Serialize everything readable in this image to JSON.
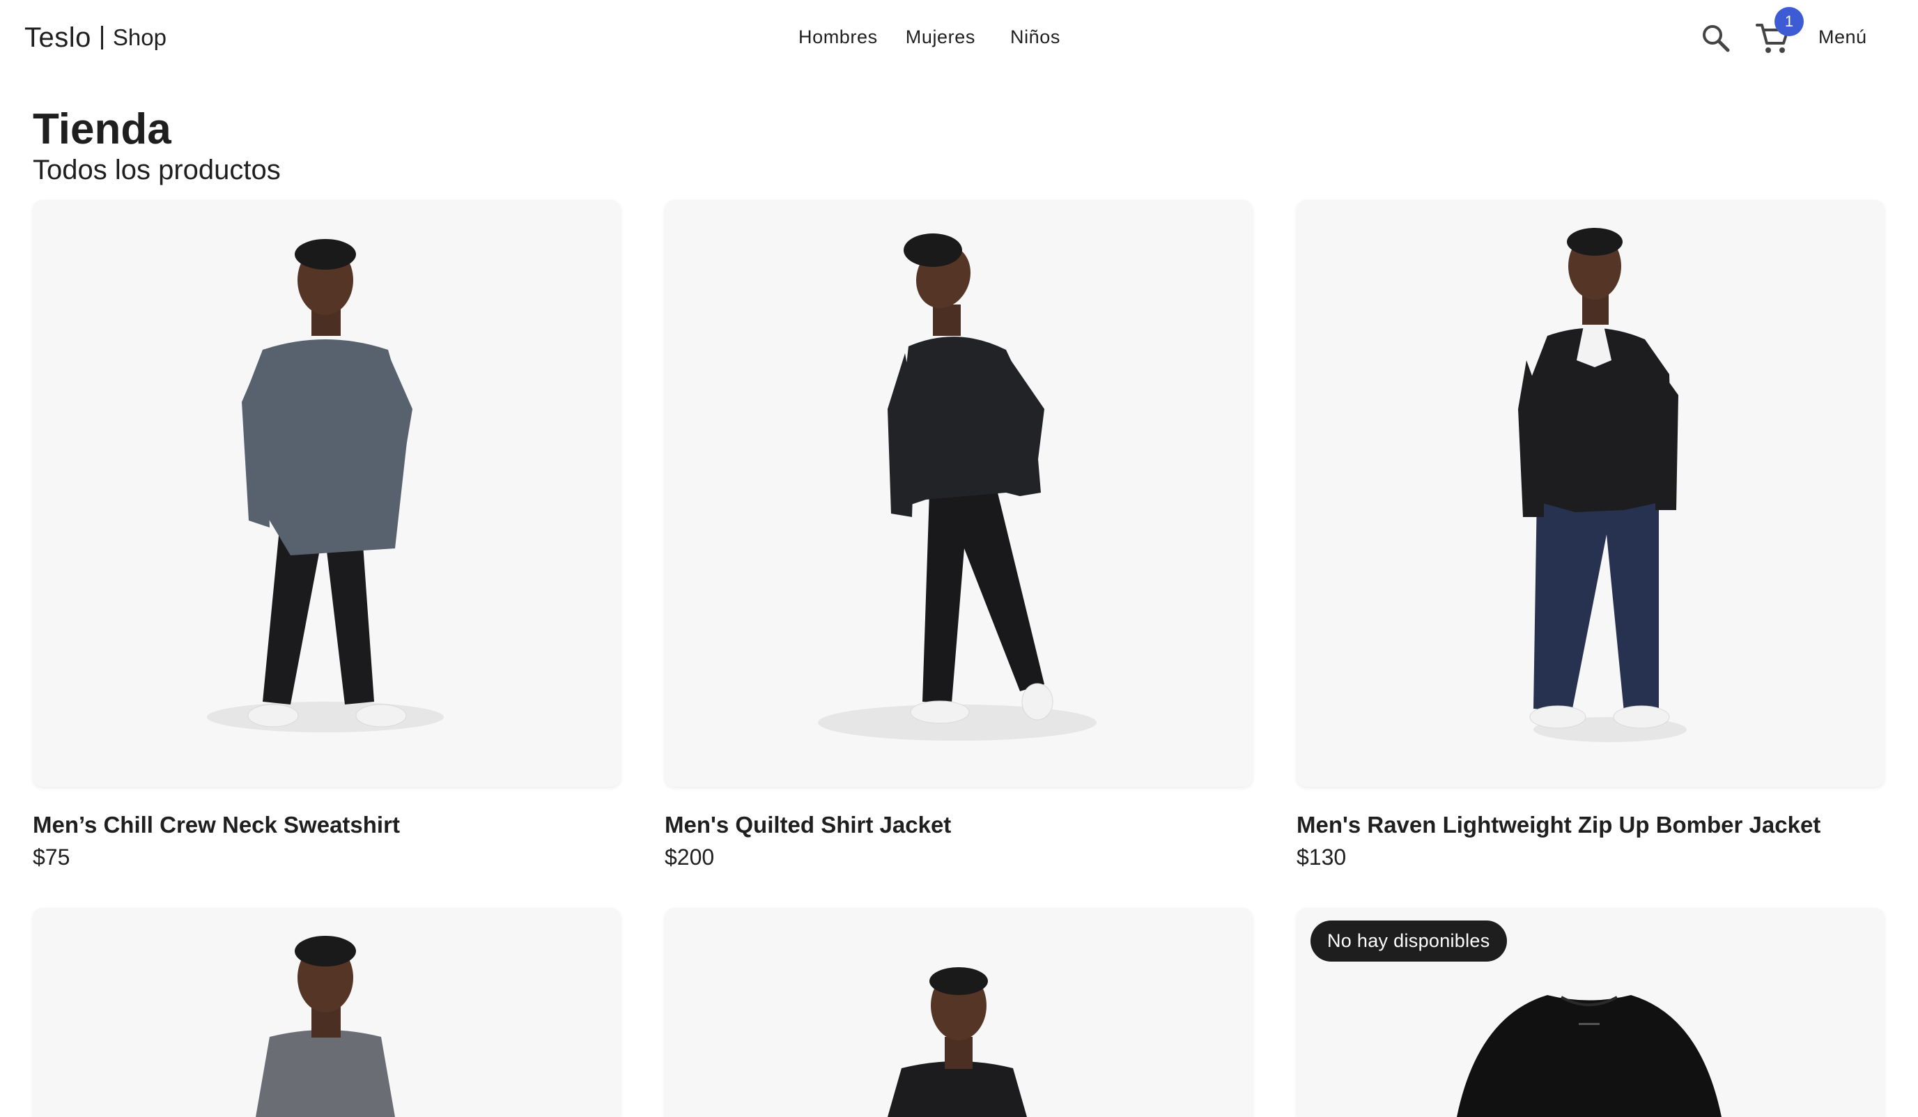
{
  "header": {
    "brand_name": "Teslo",
    "brand_sub": "Shop",
    "nav": [
      "Hombres",
      "Mujeres",
      "Niños"
    ],
    "cart_count": "1",
    "menu_label": "Menú",
    "icons": [
      "search-icon",
      "cart-icon"
    ]
  },
  "page": {
    "title": "Tienda",
    "subtitle": "Todos los productos"
  },
  "products": [
    {
      "title": "Men’s Chill Crew Neck Sweatshirt",
      "price": "$75",
      "top_color": "#58626e",
      "pants_color": "#1b1b1d"
    },
    {
      "title": "Men's Quilted Shirt Jacket",
      "price": "$200",
      "top_color": "#222326",
      "pants_color": "#19191b"
    },
    {
      "title": "Men's Raven Lightweight Zip Up Bomber Jacket",
      "price": "$130",
      "top_color": "#1d1d1f",
      "pants_color": "#26324f"
    }
  ],
  "products_row2": [
    {
      "top_color": "#6a6e74"
    },
    {
      "top_color": "#1c1c1e"
    },
    {
      "badge": "No hay disponibles",
      "top_color": "#111112"
    }
  ],
  "colors": {
    "accent_badge": "#3e5bd6",
    "card_bg": "#f7f7f7",
    "text": "#1f1f1f"
  }
}
